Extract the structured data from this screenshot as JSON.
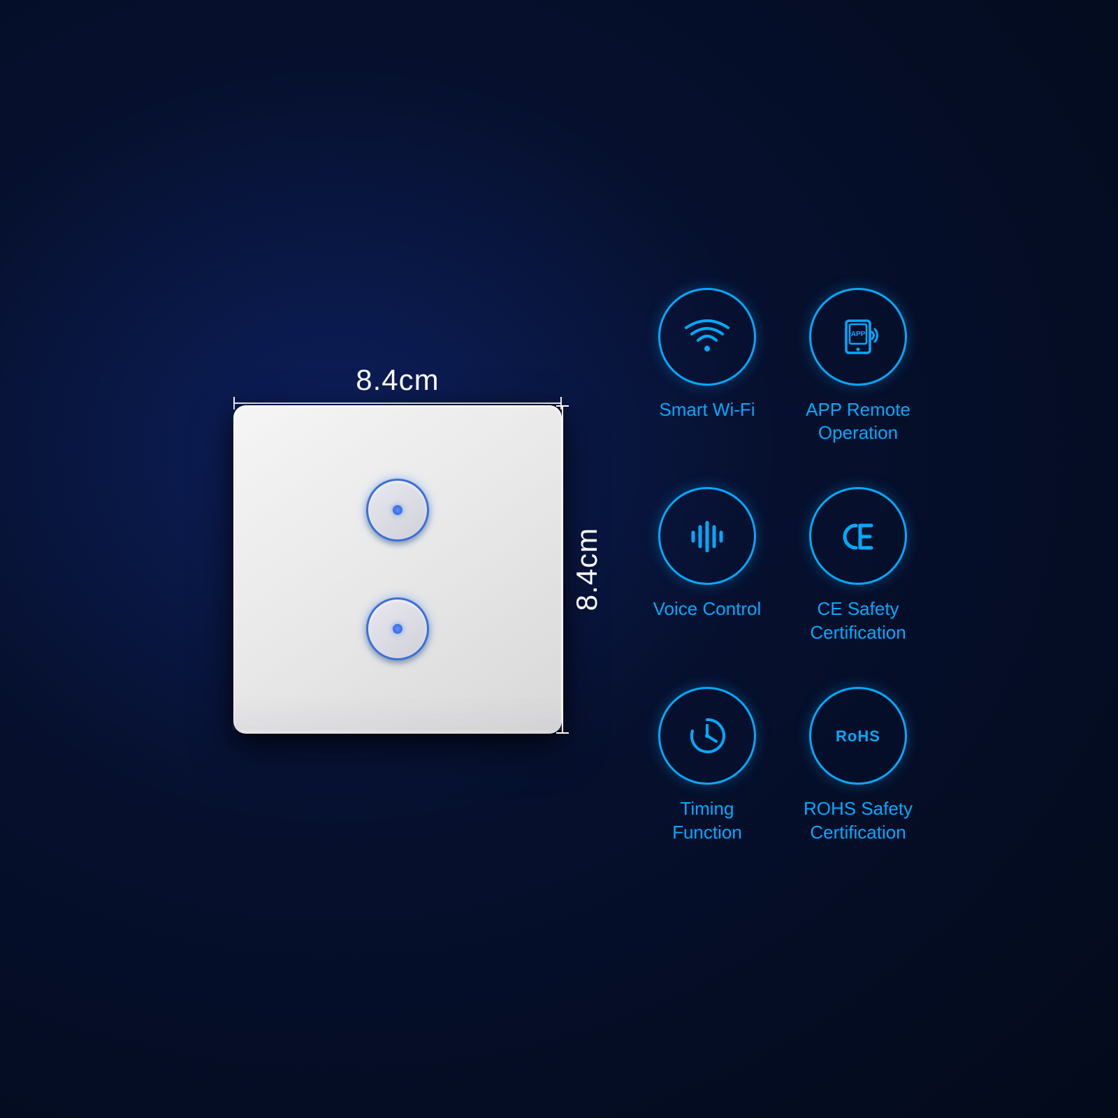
{
  "product": {
    "width_dim": "8.4cm",
    "height_dim": "8.4cm"
  },
  "features": [
    {
      "id": "smart-wifi",
      "label": "Smart Wi-Fi",
      "icon": "wifi"
    },
    {
      "id": "app-remote",
      "label": "APP Remote\nOperation",
      "icon": "app"
    },
    {
      "id": "voice-control",
      "label": "Voice Control",
      "icon": "voice"
    },
    {
      "id": "ce-safety",
      "label": "CE Safety\nCertification",
      "icon": "ce"
    },
    {
      "id": "timing-function",
      "label": "Timing\nFunction",
      "icon": "timer"
    },
    {
      "id": "rohs-safety",
      "label": "ROHS Safety\nCertification",
      "icon": "rohs"
    }
  ]
}
